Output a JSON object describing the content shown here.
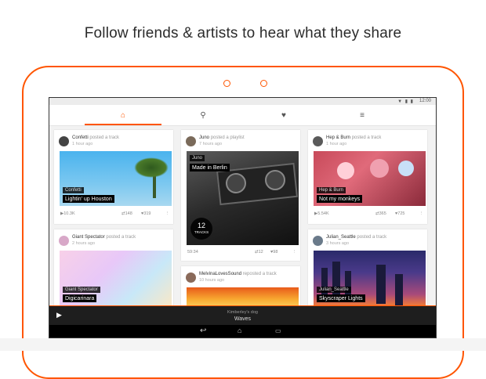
{
  "headline": "Follow friends & artists to hear what they share",
  "status": {
    "time": "12:00",
    "icons": "▼ ▮ ▮"
  },
  "tabs": [
    {
      "name": "home",
      "icon": "home-icon",
      "glyph": "⌂"
    },
    {
      "name": "search",
      "icon": "search-icon",
      "glyph": "⚲"
    },
    {
      "name": "likes",
      "icon": "heart-icon",
      "glyph": "♥"
    },
    {
      "name": "menu",
      "icon": "menu-icon",
      "glyph": "≡"
    }
  ],
  "cards": [
    {
      "user": "Confetti",
      "verb": "posted a track",
      "time": "1 hour ago",
      "label_user": "Confetti",
      "label_title": "Lightin' up Houston",
      "plays": "10.3K",
      "reposts": "148",
      "likes": "319"
    },
    {
      "user": "Juno",
      "verb": "posted a playlist",
      "time": "7 hours ago",
      "label_user": "Juno",
      "label_title": "Made in Berlin",
      "tracks_count": "12",
      "tracks_label": "TRACKS",
      "duration": "59:34",
      "reposts": "12",
      "likes": "98"
    },
    {
      "user": "Hep & Burn",
      "verb": "posted a track",
      "time": "1 hour ago",
      "label_user": "Hep & Burn",
      "label_title": "Not my monkeys",
      "plays": "5.54K",
      "reposts": "365",
      "likes": "725"
    },
    {
      "user": "Giant Spectator",
      "verb": "posted a track",
      "time": "2 hours ago",
      "label_user": "Giant Spectator",
      "label_title": "Digicarinara"
    },
    {
      "user": "MelvinaLovesSound",
      "verb": "reposted a track",
      "time": "10 hours ago"
    },
    {
      "user": "Julian_Seattle",
      "verb": "posted a track",
      "time": "3 hours ago",
      "label_user": "Julian_Seattle",
      "label_title": "Skyscraper Lights"
    }
  ],
  "player": {
    "subtitle": "Kimberley's dog",
    "title": "Waves"
  },
  "colors": {
    "accent": "#ff5500"
  }
}
